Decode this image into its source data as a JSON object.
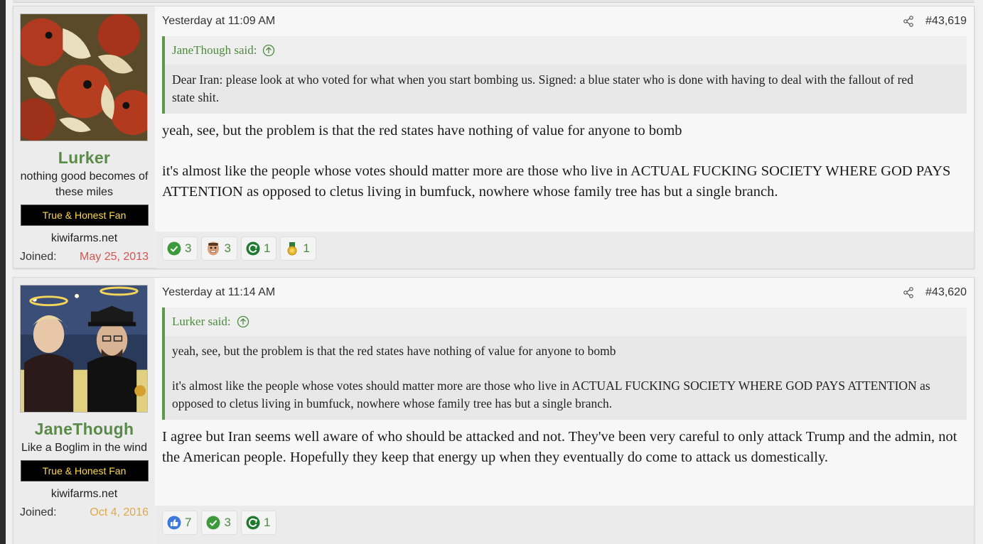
{
  "posts": [
    {
      "user": {
        "name": "Lurker",
        "title": "nothing good becomes of these miles",
        "banner": "True & Honest Fan",
        "site": "kiwifarms.net",
        "joined_label": "Joined:",
        "joined_date": "May 25, 2013"
      },
      "timestamp": "Yesterday at 11:09 AM",
      "post_number": "#43,619",
      "quote": {
        "author": "JaneThough said:",
        "paragraphs": [
          "Dear Iran: please look at who voted for what when you start bombing us. Signed: a blue stater who is done with having to deal with the fallout of red state shit."
        ]
      },
      "body": [
        "yeah, see, but the problem is that the red states have nothing of value for anyone to bomb",
        "it's almost like the people whose votes should matter more are those who live in ACTUAL FUCKING SOCIETY WHERE GOD PAYS ATTENTION as opposed to cletus living in bumfuck, nowhere whose family tree has but a single branch."
      ],
      "reactions": [
        {
          "icon": "check-icon",
          "count": "3"
        },
        {
          "icon": "face-icon",
          "count": "3"
        },
        {
          "icon": "recycle-icon",
          "count": "1"
        },
        {
          "icon": "medal-icon",
          "count": "1"
        }
      ]
    },
    {
      "user": {
        "name": "JaneThough",
        "title": "Like a Boglim in the wind",
        "banner": "True & Honest Fan",
        "site": "kiwifarms.net",
        "joined_label": "Joined:",
        "joined_date": "Oct 4, 2016"
      },
      "timestamp": "Yesterday at 11:14 AM",
      "post_number": "#43,620",
      "quote": {
        "author": "Lurker said:",
        "paragraphs": [
          "yeah, see, but the problem is that the red states have nothing of value for anyone to bomb",
          "it's almost like the people whose votes should matter more are those who live in ACTUAL FUCKING SOCIETY WHERE GOD PAYS ATTENTION as opposed to cletus living in bumfuck, nowhere whose family tree has but a single branch."
        ]
      },
      "body": [
        "I agree but Iran seems well aware of who should be attacked and not. They've been very careful to only attack Trump and the admin, not the American people. Hopefully they keep that energy up when they eventually do come to attack us domestically."
      ],
      "reactions": [
        {
          "icon": "thumbs-up-icon",
          "count": "7"
        },
        {
          "icon": "check-icon",
          "count": "3"
        },
        {
          "icon": "recycle-icon",
          "count": "1"
        }
      ]
    }
  ],
  "colors": {
    "username": "#5a8a48",
    "quote_border": "#5a9a48",
    "banner_text": "#ffd84a",
    "joined_date_1": "#d9534f",
    "joined_date_2": "#e0a84a"
  }
}
